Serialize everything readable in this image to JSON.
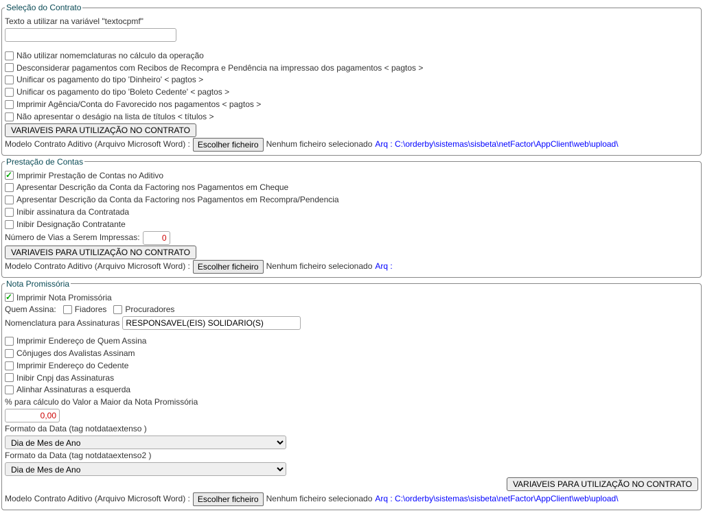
{
  "section1": {
    "legend": "Seleção do Contrato",
    "texto_label": "Texto a utilizar na variável \"textocpmf\"",
    "texto_value": "",
    "chk1": "Não utilizar nomemclaturas no cálculo da operação",
    "chk2": "Desconsiderar pagamentos com Recibos de Recompra e Pendência na impressao dos pagamentos < pagtos >",
    "chk3": "Unificar os pagamento do tipo 'Dinheiro' < pagtos >",
    "chk4": "Unificar os pagamento do tipo 'Boleto Cedente' < pagtos >",
    "chk5": "Imprimir Agência/Conta do Favorecido nos pagamentos < pagtos >",
    "chk6": "Não apresentar o deságio na lista de títulos < títulos >",
    "btn_vars": "VARIAVEIS PARA UTILIZAÇÃO NO CONTRATO",
    "modelo_label": "Modelo Contrato Aditivo (Arquivo Microsoft Word) :",
    "escolher": "Escolher ficheiro",
    "nenhum": "Nenhum ficheiro selecionado",
    "arq": "Arq : C:\\orderby\\sistemas\\sisbeta\\netFactor\\AppClient\\web\\upload\\"
  },
  "section2": {
    "legend": "Prestação de Contas",
    "chk1": "Imprimir Prestação de Contas no Aditivo",
    "chk2": "Apresentar Descrição da Conta da Factoring nos Pagamentos em Cheque",
    "chk3": "Apresentar Descrição da Conta da Factoring nos Pagamentos em Recompra/Pendencia",
    "chk4": "Inibir assinatura da Contratada",
    "chk5": "Inibir Designação Contratante",
    "vias_label": "Número de Vias a Serem Impressas:",
    "vias_value": "0",
    "btn_vars": "VARIAVEIS PARA UTILIZAÇÃO NO CONTRATO",
    "modelo_label": "Modelo Contrato Aditivo (Arquivo Microsoft Word) :",
    "escolher": "Escolher ficheiro",
    "nenhum": "Nenhum ficheiro selecionado",
    "arq": "Arq :"
  },
  "section3": {
    "legend": "Nota Promissória",
    "chk1": "Imprimir Nota Promissória",
    "quem_label": "Quem Assina:",
    "fiadores": "Fiadores",
    "procuradores": "Procuradores",
    "nom_label": "Nomenclatura para Assinaturas",
    "nom_value": "RESPONSAVEL(EIS) SOLIDARIO(S)",
    "chk_endereco": "Imprimir Endereço de Quem Assina",
    "chk_conjuges": "Cônjuges dos Avalistas Assinam",
    "chk_ced": "Imprimir Endereço do Cedente",
    "chk_cnpj": "Inibir Cnpj das Assinaturas",
    "chk_alinhar": "Alinhar Assinaturas a esquerda",
    "pct_label": "% para cálculo do Valor a Maior da Nota Promissória",
    "pct_value": "0,00",
    "fmt1_label": "Formato da Data (tag notdataextenso )",
    "fmt2_label": "Formato da Data (tag notdataextenso2 )",
    "fmt_option": "Dia de Mes de Ano",
    "btn_vars": "VARIAVEIS PARA UTILIZAÇÃO NO CONTRATO",
    "modelo_label": "Modelo Contrato Aditivo (Arquivo Microsoft Word) :",
    "escolher": "Escolher ficheiro",
    "nenhum": "Nenhum ficheiro selecionado",
    "arq": "Arq : C:\\orderby\\sistemas\\sisbeta\\netFactor\\AppClient\\web\\upload\\"
  }
}
